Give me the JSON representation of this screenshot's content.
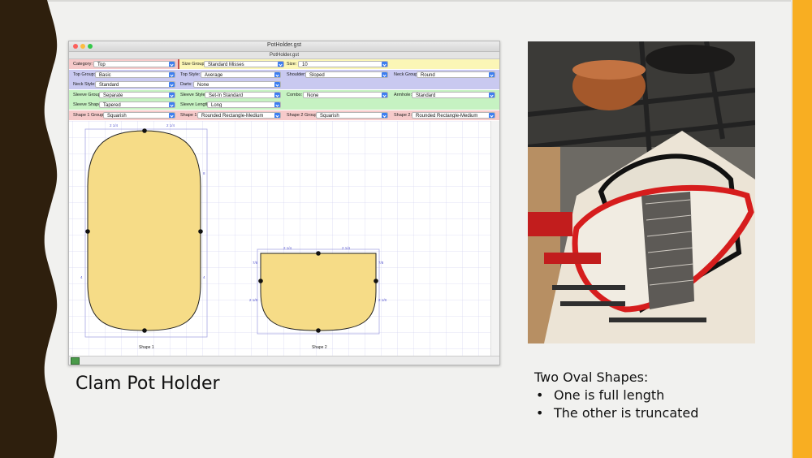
{
  "window": {
    "title": "PotHolder.gst",
    "tab_title": "PotHolder.gst"
  },
  "rows": {
    "category": {
      "label": "Category:",
      "value": "Top"
    },
    "size_group": {
      "label": "Size Group:",
      "value": "Standard Misses"
    },
    "size": {
      "label": "Size:",
      "value": "10"
    },
    "top_group": {
      "label": "Top Group:",
      "value": "Basic"
    },
    "top_style": {
      "label": "Top Style:",
      "value": "Average"
    },
    "shoulder": {
      "label": "Shoulder:",
      "value": "Sloped"
    },
    "neck_group": {
      "label": "Neck Group:",
      "value": "Round"
    },
    "neck_style": {
      "label": "Neck Style:",
      "value": "Standard"
    },
    "darts": {
      "label": "Darts:",
      "value": "None"
    },
    "sleeve_group": {
      "label": "Sleeve Group:",
      "value": "Separate"
    },
    "sleeve_style": {
      "label": "Sleeve Style:",
      "value": "Set-In Standard"
    },
    "combo": {
      "label": "Combo:",
      "value": "None"
    },
    "armhole": {
      "label": "Armhole:",
      "value": "Standard"
    },
    "sleeve_shape": {
      "label": "Sleeve Shape:",
      "value": "Tapered"
    },
    "sleeve_length": {
      "label": "Sleeve Length:",
      "value": "Long"
    },
    "shape1_group": {
      "label": "Shape 1 Group:",
      "value": "Squarish"
    },
    "shape1": {
      "label": "Shape 1:",
      "value": "Rounded Rectangle-Medium"
    },
    "shape2_group": {
      "label": "Shape 2 Group:",
      "value": "Squarish"
    },
    "shape2": {
      "label": "Shape 2:",
      "value": "Rounded Rectangle-Medium"
    }
  },
  "canvas": {
    "shape1_label": "Shape 1",
    "shape2_label": "Shape 2",
    "dims": [
      "2 1/4",
      "2 1/4",
      "8",
      "4",
      "4",
      "2 1/4",
      "2 1/4",
      "7/8",
      "7/8",
      "2 1/8",
      "2 1/8"
    ]
  },
  "colors": {
    "shape_fill": "#f6dc87",
    "grid": "#c9c9ec",
    "row_pink": "#f6caca",
    "row_yellow": "#fbf6b6",
    "row_purple": "#c9c9f0",
    "row_green": "#c6f2c2",
    "accent_orange": "#f8ae22",
    "wavy_brown": "#2e1f0d"
  },
  "slide": {
    "title": "Clam Pot Holder",
    "notes_heading": "Two Oval Shapes:",
    "bullets": [
      "One is full length",
      "The other is truncated"
    ]
  }
}
